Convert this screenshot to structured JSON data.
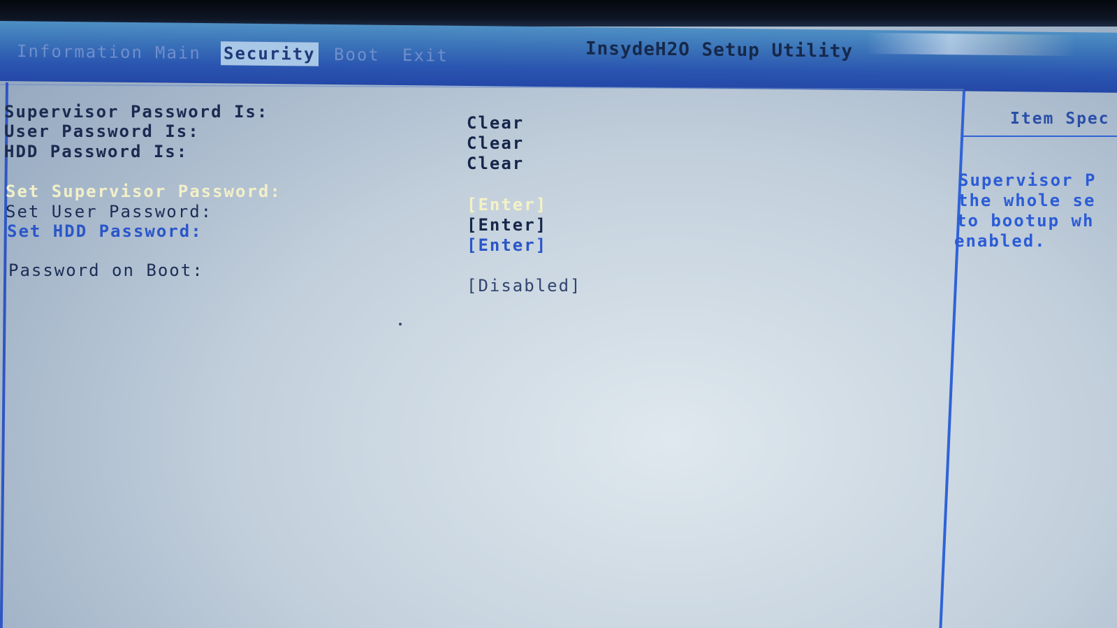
{
  "header": {
    "title": "InsydeH2O Setup Utility",
    "tabs": [
      {
        "label": "Information",
        "active": false
      },
      {
        "label": "Main",
        "active": false
      },
      {
        "label": "Security",
        "active": true
      },
      {
        "label": "Boot",
        "active": false
      },
      {
        "label": "Exit",
        "active": false
      }
    ]
  },
  "security": {
    "status": [
      {
        "label": "Supervisor Password Is:",
        "value": "Clear"
      },
      {
        "label": "User Password Is:",
        "value": "Clear"
      },
      {
        "label": "HDD Password Is:",
        "value": "Clear"
      }
    ],
    "actions": [
      {
        "label": "Set Supervisor Password:",
        "value": "[Enter]",
        "selected": true
      },
      {
        "label": "Set User Password:",
        "value": "[Enter]",
        "selected": false
      },
      {
        "label": "Set HDD Password:",
        "value": "[Enter]",
        "selected": false
      }
    ],
    "boot_option": {
      "label": "Password on Boot:",
      "value": "[Disabled]"
    }
  },
  "help": {
    "title": "Item Spec",
    "lines": [
      "Supervisor P",
      "the whole se",
      "to bootup wh",
      "enabled."
    ]
  },
  "colors": {
    "menubar": "#2a55b0",
    "active_tab": "#a9c7e6",
    "panel": "#c3d0dc",
    "selected_text": "#f2f0c8",
    "help_text": "#2b5cd6"
  }
}
